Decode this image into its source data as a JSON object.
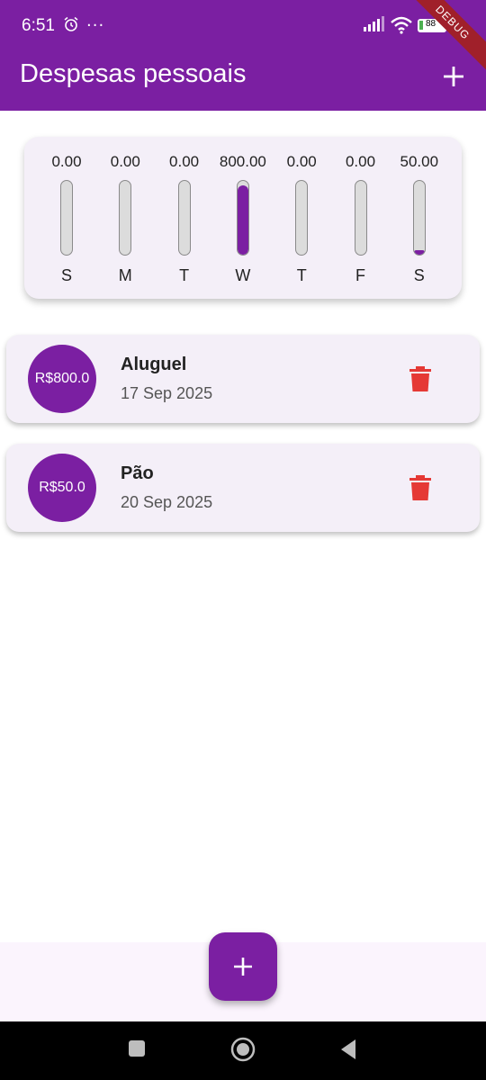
{
  "status_bar": {
    "time": "6:51",
    "more": "···",
    "battery": "88",
    "debug_label": "DEBUG"
  },
  "app_bar": {
    "title": "Despesas pessoais",
    "add_icon": "plus-icon"
  },
  "chart_data": {
    "type": "bar",
    "categories": [
      "S",
      "M",
      "T",
      "W",
      "T",
      "F",
      "S"
    ],
    "values": [
      0.0,
      0.0,
      0.0,
      800.0,
      0.0,
      0.0,
      50.0
    ],
    "value_labels": [
      "0.00",
      "0.00",
      "0.00",
      "800.00",
      "0.00",
      "0.00",
      "50.00"
    ],
    "ylim": [
      0,
      850
    ]
  },
  "transactions": [
    {
      "amount": "R$800.0",
      "title": "Aluguel",
      "date": "17 Sep 2025",
      "delete_icon": "trash-icon"
    },
    {
      "amount": "R$50.0",
      "title": "Pão",
      "date": "20 Sep 2025",
      "delete_icon": "trash-icon"
    }
  ],
  "colors": {
    "primary": "#7b1fa2",
    "card": "#f4eff8",
    "delete": "#e53935"
  },
  "navigation": {
    "recent": "square-icon",
    "home": "circle-icon",
    "back": "triangle-back-icon"
  }
}
